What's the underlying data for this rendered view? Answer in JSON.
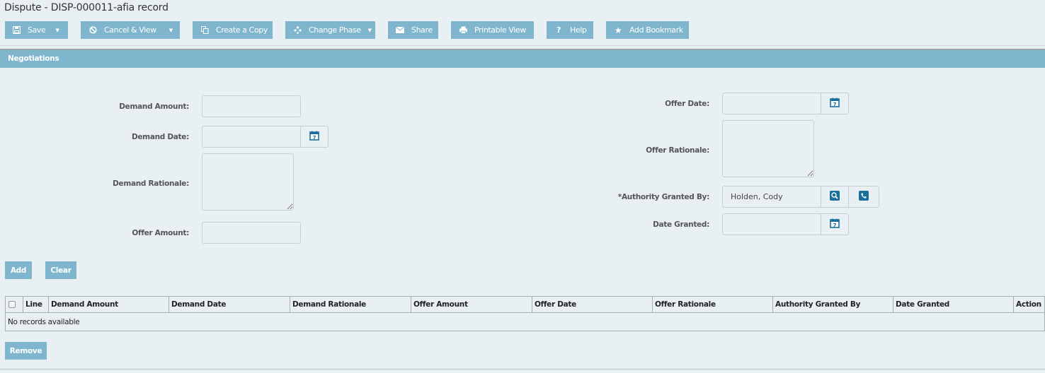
{
  "page": {
    "title": "Dispute - DISP-000011-afia record"
  },
  "toolbar": {
    "buttons": [
      {
        "label": "Save",
        "icon": "save-icon",
        "has_dropdown": true
      },
      {
        "label": "Cancel & View",
        "icon": "cancel-icon",
        "has_dropdown": true
      },
      {
        "label": "Create a Copy",
        "icon": "copy-icon",
        "has_dropdown": false
      },
      {
        "label": "Change Phase",
        "icon": "phase-icon",
        "has_dropdown": true
      },
      {
        "label": "Share",
        "icon": "envelope-icon",
        "has_dropdown": false
      },
      {
        "label": "Printable View",
        "icon": "printer-icon",
        "has_dropdown": false
      },
      {
        "label": "Help",
        "icon": "question-icon",
        "has_dropdown": false
      },
      {
        "label": "Add Bookmark",
        "icon": "star-icon",
        "has_dropdown": false
      }
    ]
  },
  "section": {
    "title": "Negotiations"
  },
  "form": {
    "demand_amount": {
      "label": "Demand Amount:",
      "value": ""
    },
    "demand_date": {
      "label": "Demand Date:",
      "value": ""
    },
    "demand_rationale": {
      "label": "Demand Rationale:",
      "value": ""
    },
    "offer_amount": {
      "label": "Offer Amount:",
      "value": ""
    },
    "offer_date": {
      "label": "Offer Date:",
      "value": ""
    },
    "offer_rationale": {
      "label": "Offer Rationale:",
      "value": ""
    },
    "authority_granted_by": {
      "label": "*Authority Granted By:",
      "value": "Holden, Cody"
    },
    "date_granted": {
      "label": "Date Granted:",
      "value": ""
    }
  },
  "actions": {
    "add": "Add",
    "clear": "Clear",
    "remove": "Remove"
  },
  "table": {
    "columns": [
      "Line",
      "Demand Amount",
      "Demand Date",
      "Demand Rationale",
      "Offer Amount",
      "Offer Date",
      "Offer Rationale",
      "Authority Granted By",
      "Date Granted",
      "Action"
    ],
    "empty_message": "No records available"
  },
  "colors": {
    "accent": "#7fb6ce",
    "icon_blue": "#1a6f9a",
    "background": "#e9f0f4"
  }
}
